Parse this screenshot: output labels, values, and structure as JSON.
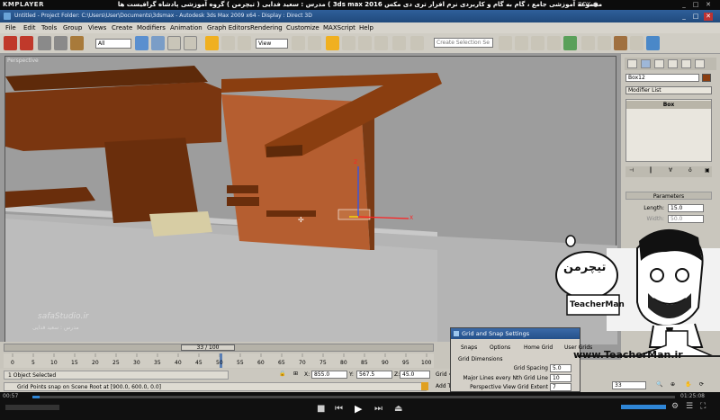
{
  "player": {
    "logo": "KMPLAYER",
    "title": "مجموعه آموزشی جامع ، گام به گام و کاربردی نرم افزار تری دی مکس 3ds max 2016 ) مدرس : سعید فدایی ( تیچرمن ) گروه آموزشی پادشاه گرافیست ها",
    "box_label": "BOX ●"
  },
  "window": {
    "title": "Untitled   - Project Folder: C:\\Users\\User\\Documents\\3dsmax       - Autodesk 3ds Max  2009 x64       - Display : Direct 3D"
  },
  "menu": [
    "File",
    "Edit",
    "Tools",
    "Group",
    "Views",
    "Create",
    "Modifiers",
    "Animation",
    "Graph Editors",
    "Rendering",
    "Customize",
    "MAXScript",
    "Help"
  ],
  "toolbar": {
    "filter_value": "All",
    "refcoord_value": "View",
    "selset_placeholder": "Create Selection Se"
  },
  "viewport": {
    "label": "Perspective",
    "watermark1": "safaStudio.ir",
    "watermark2": "مدرس : سعید فدایی"
  },
  "command_panel": {
    "object_name": "Box12",
    "modifier_list": "Modifier List",
    "stack_item": "Box",
    "rollout": "Parameters",
    "length_label": "Length:",
    "length_value": "15.0",
    "width_label": "Width:",
    "width_value": "50.0"
  },
  "timeline": {
    "frame": "33 / 100",
    "ticks": [
      "0",
      "5",
      "10",
      "15",
      "20",
      "25",
      "30",
      "35",
      "40",
      "45",
      "50",
      "55",
      "60",
      "65",
      "70",
      "75",
      "80",
      "85",
      "90",
      "95",
      "100"
    ]
  },
  "status": {
    "selection": "1 Object Selected",
    "prompt": "Grid Points snap on Scene Root at [900.0, 600.0, 0.0]",
    "x_label": "X:",
    "x_value": "855.0",
    "y_label": "Y:",
    "y_value": "567.5",
    "z_label": "Z:",
    "z_value": "45.0",
    "grid_label": "Grid =",
    "add_tag": "Add T",
    "frame_field": "33"
  },
  "grid_dialog": {
    "title": "Grid and Snap Settings",
    "tabs": [
      "Snaps",
      "Options",
      "Home Grid",
      "User Grids"
    ],
    "group": "Grid Dimensions",
    "rows": [
      {
        "label": "Grid Spacing",
        "value": "5.0"
      },
      {
        "label": "Major Lines every Nth Grid Line",
        "value": "10"
      },
      {
        "label": "Perspective View Grid Extent",
        "value": "7"
      }
    ]
  },
  "teacher": {
    "name": "TeacherMan",
    "url": "www.TeacherMan.ir",
    "persian": "تیچرمن"
  },
  "player_ctrl": {
    "elapsed": "00:57",
    "total": "01:25:08"
  },
  "colors": {
    "wood": "#8b3e10",
    "wood_dark": "#5e2a0a",
    "player": "#101010",
    "titlebar": "#2a578e"
  }
}
